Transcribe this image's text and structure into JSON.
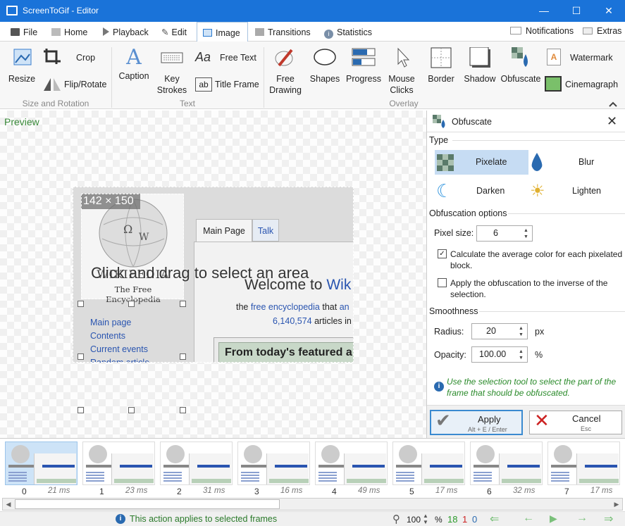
{
  "window": {
    "title": "ScreenToGif - Editor",
    "minimize": "—",
    "maximize": "☐",
    "close": "✕"
  },
  "menu_tabs": [
    "File",
    "Home",
    "Playback",
    "Edit",
    "Image",
    "Transitions",
    "Statistics"
  ],
  "right_tabs": {
    "notifications": "Notifications",
    "extras": "Extras"
  },
  "ribbon": {
    "resize": "Resize",
    "crop": "Crop",
    "flip_rotate": "Flip/Rotate",
    "group_size": "Size and Rotation",
    "caption": "Caption",
    "key_strokes_1": "Key",
    "key_strokes_2": "Strokes",
    "free_text": "Free Text",
    "title_frame": "Title Frame",
    "group_text": "Text",
    "free_drawing_1": "Free",
    "free_drawing_2": "Drawing",
    "shapes": "Shapes",
    "progress": "Progress",
    "mouse_clicks_1": "Mouse",
    "mouse_clicks_2": "Clicks",
    "border": "Border",
    "shadow": "Shadow",
    "obfuscate": "Obfuscate",
    "group_overlay": "Overlay",
    "watermark": "Watermark",
    "cinemagraph": "Cinemagraph"
  },
  "preview": {
    "label": "Preview",
    "selection_size": "142 × 150",
    "hint": "Click and drag to select an area"
  },
  "wiki": {
    "wordmark": "WIKIPEDIA",
    "tagline": "The Free Encyclopedia",
    "tab_main": "Main Page",
    "tab_talk": "Talk",
    "welcome": "Welcome to",
    "welcome_link": "Wik",
    "line2a": "the",
    "line2_link": "free encyclopedia",
    "line2b": "that",
    "line2c": "an",
    "count": "6,140,574",
    "count_b": "articles in",
    "count_c": "E",
    "featured": "From today's featured a",
    "nav": [
      "Main page",
      "Contents",
      "Current events",
      "Random article"
    ]
  },
  "panel": {
    "title": "Obfuscate",
    "type_label": "Type",
    "pixelate": "Pixelate",
    "blur": "Blur",
    "darken": "Darken",
    "lighten": "Lighten",
    "options_label": "Obfuscation options",
    "pixel_size_label": "Pixel size:",
    "pixel_size": "6",
    "avg_color": "Calculate the average color for each pixelated block.",
    "inverse": "Apply the obfuscation to the inverse of the selection.",
    "smooth_label": "Smoothness",
    "radius_label": "Radius:",
    "radius": "20",
    "radius_unit": "px",
    "opacity_label": "Opacity:",
    "opacity": "100.00",
    "opacity_unit": "%",
    "info": "Use the selection tool to select the part of the frame that should be obfuscated.",
    "apply": "Apply",
    "apply_hint": "Alt + E / Enter",
    "cancel": "Cancel",
    "cancel_hint": "Esc"
  },
  "frames": [
    {
      "n": "0",
      "ms": "21 ms"
    },
    {
      "n": "1",
      "ms": "23 ms"
    },
    {
      "n": "2",
      "ms": "31 ms"
    },
    {
      "n": "3",
      "ms": "16 ms"
    },
    {
      "n": "4",
      "ms": "49 ms"
    },
    {
      "n": "5",
      "ms": "17 ms"
    },
    {
      "n": "6",
      "ms": "32 ms"
    },
    {
      "n": "7",
      "ms": "17 ms"
    }
  ],
  "status": {
    "message": "This action applies to selected frames",
    "zoom": "100",
    "zoom_unit": "%",
    "total": "18",
    "selected": "1",
    "current": "0"
  },
  "colors": {
    "accent": "#1a73d9",
    "green": "#3a8a3a",
    "red": "#cc2222"
  }
}
